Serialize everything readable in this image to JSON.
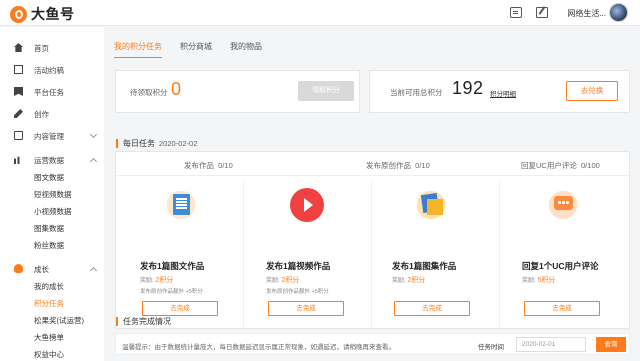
{
  "brand": {
    "name": "大鱼号"
  },
  "header": {
    "username": "网络生活..."
  },
  "sidebar": {
    "items": [
      {
        "label": "首页"
      },
      {
        "label": "活动约稿"
      },
      {
        "label": "平台任务"
      },
      {
        "label": "创作"
      },
      {
        "label": "内容管理"
      },
      {
        "label": "运营数据"
      },
      {
        "label": "图文数据"
      },
      {
        "label": "短视频数据"
      },
      {
        "label": "小视频数据"
      },
      {
        "label": "图集数据"
      },
      {
        "label": "粉丝数据"
      },
      {
        "label": "成长"
      },
      {
        "label": "我的成长"
      },
      {
        "label": "积分任务"
      },
      {
        "label": "松果奖(试运营)"
      },
      {
        "label": "大鱼榜单"
      },
      {
        "label": "权益中心"
      }
    ]
  },
  "tabs": [
    {
      "label": "我的积分任务"
    },
    {
      "label": "积分商城"
    },
    {
      "label": "我的物品"
    }
  ],
  "points": {
    "pending_label": "待领取积分",
    "pending_value": "0",
    "claim_label": "领取积分",
    "total_label": "当前可用总积分",
    "total_value": "192",
    "detail_link": "积分明细",
    "redeem_label": "去兑换"
  },
  "daily": {
    "title": "每日任务",
    "date": "2020-02-02",
    "categories": [
      {
        "name": "发布作品",
        "progress": "0/10"
      },
      {
        "name": "发布原创作品",
        "progress": "0/10"
      },
      {
        "name": "回复UC用户评论",
        "progress": "0/100"
      }
    ],
    "tasks": [
      {
        "icon": "article-icon",
        "title": "发布1篇图文作品",
        "reward_prefix": "奖励:",
        "reward": "2积分",
        "extra": "发布原创作品额外 +5积分",
        "button": "去完成"
      },
      {
        "icon": "video-icon",
        "title": "发布1篇视频作品",
        "reward_prefix": "奖励:",
        "reward": "2积分",
        "extra": "发布原创作品额外 +5积分",
        "button": "去完成"
      },
      {
        "icon": "gallery-icon",
        "title": "发布1篇图集作品",
        "reward_prefix": "奖励:",
        "reward": "2积分",
        "extra": "",
        "button": "去完成"
      },
      {
        "icon": "comment-icon",
        "title": "回复1个UC用户评论",
        "reward_prefix": "奖励:",
        "reward": "5积分",
        "extra": "",
        "button": "去完成"
      }
    ]
  },
  "completion": {
    "title": "任务完成情况"
  },
  "footer": {
    "hint": "温馨提示：由于数据统计量庞大，每日数据延迟显示属正常现象，如遇延迟，请稍晚再来查看。",
    "time_label": "任务时间",
    "date_value": "2020-02-01",
    "button": "查询"
  },
  "colors": {
    "accent": "#ff7a1a"
  }
}
